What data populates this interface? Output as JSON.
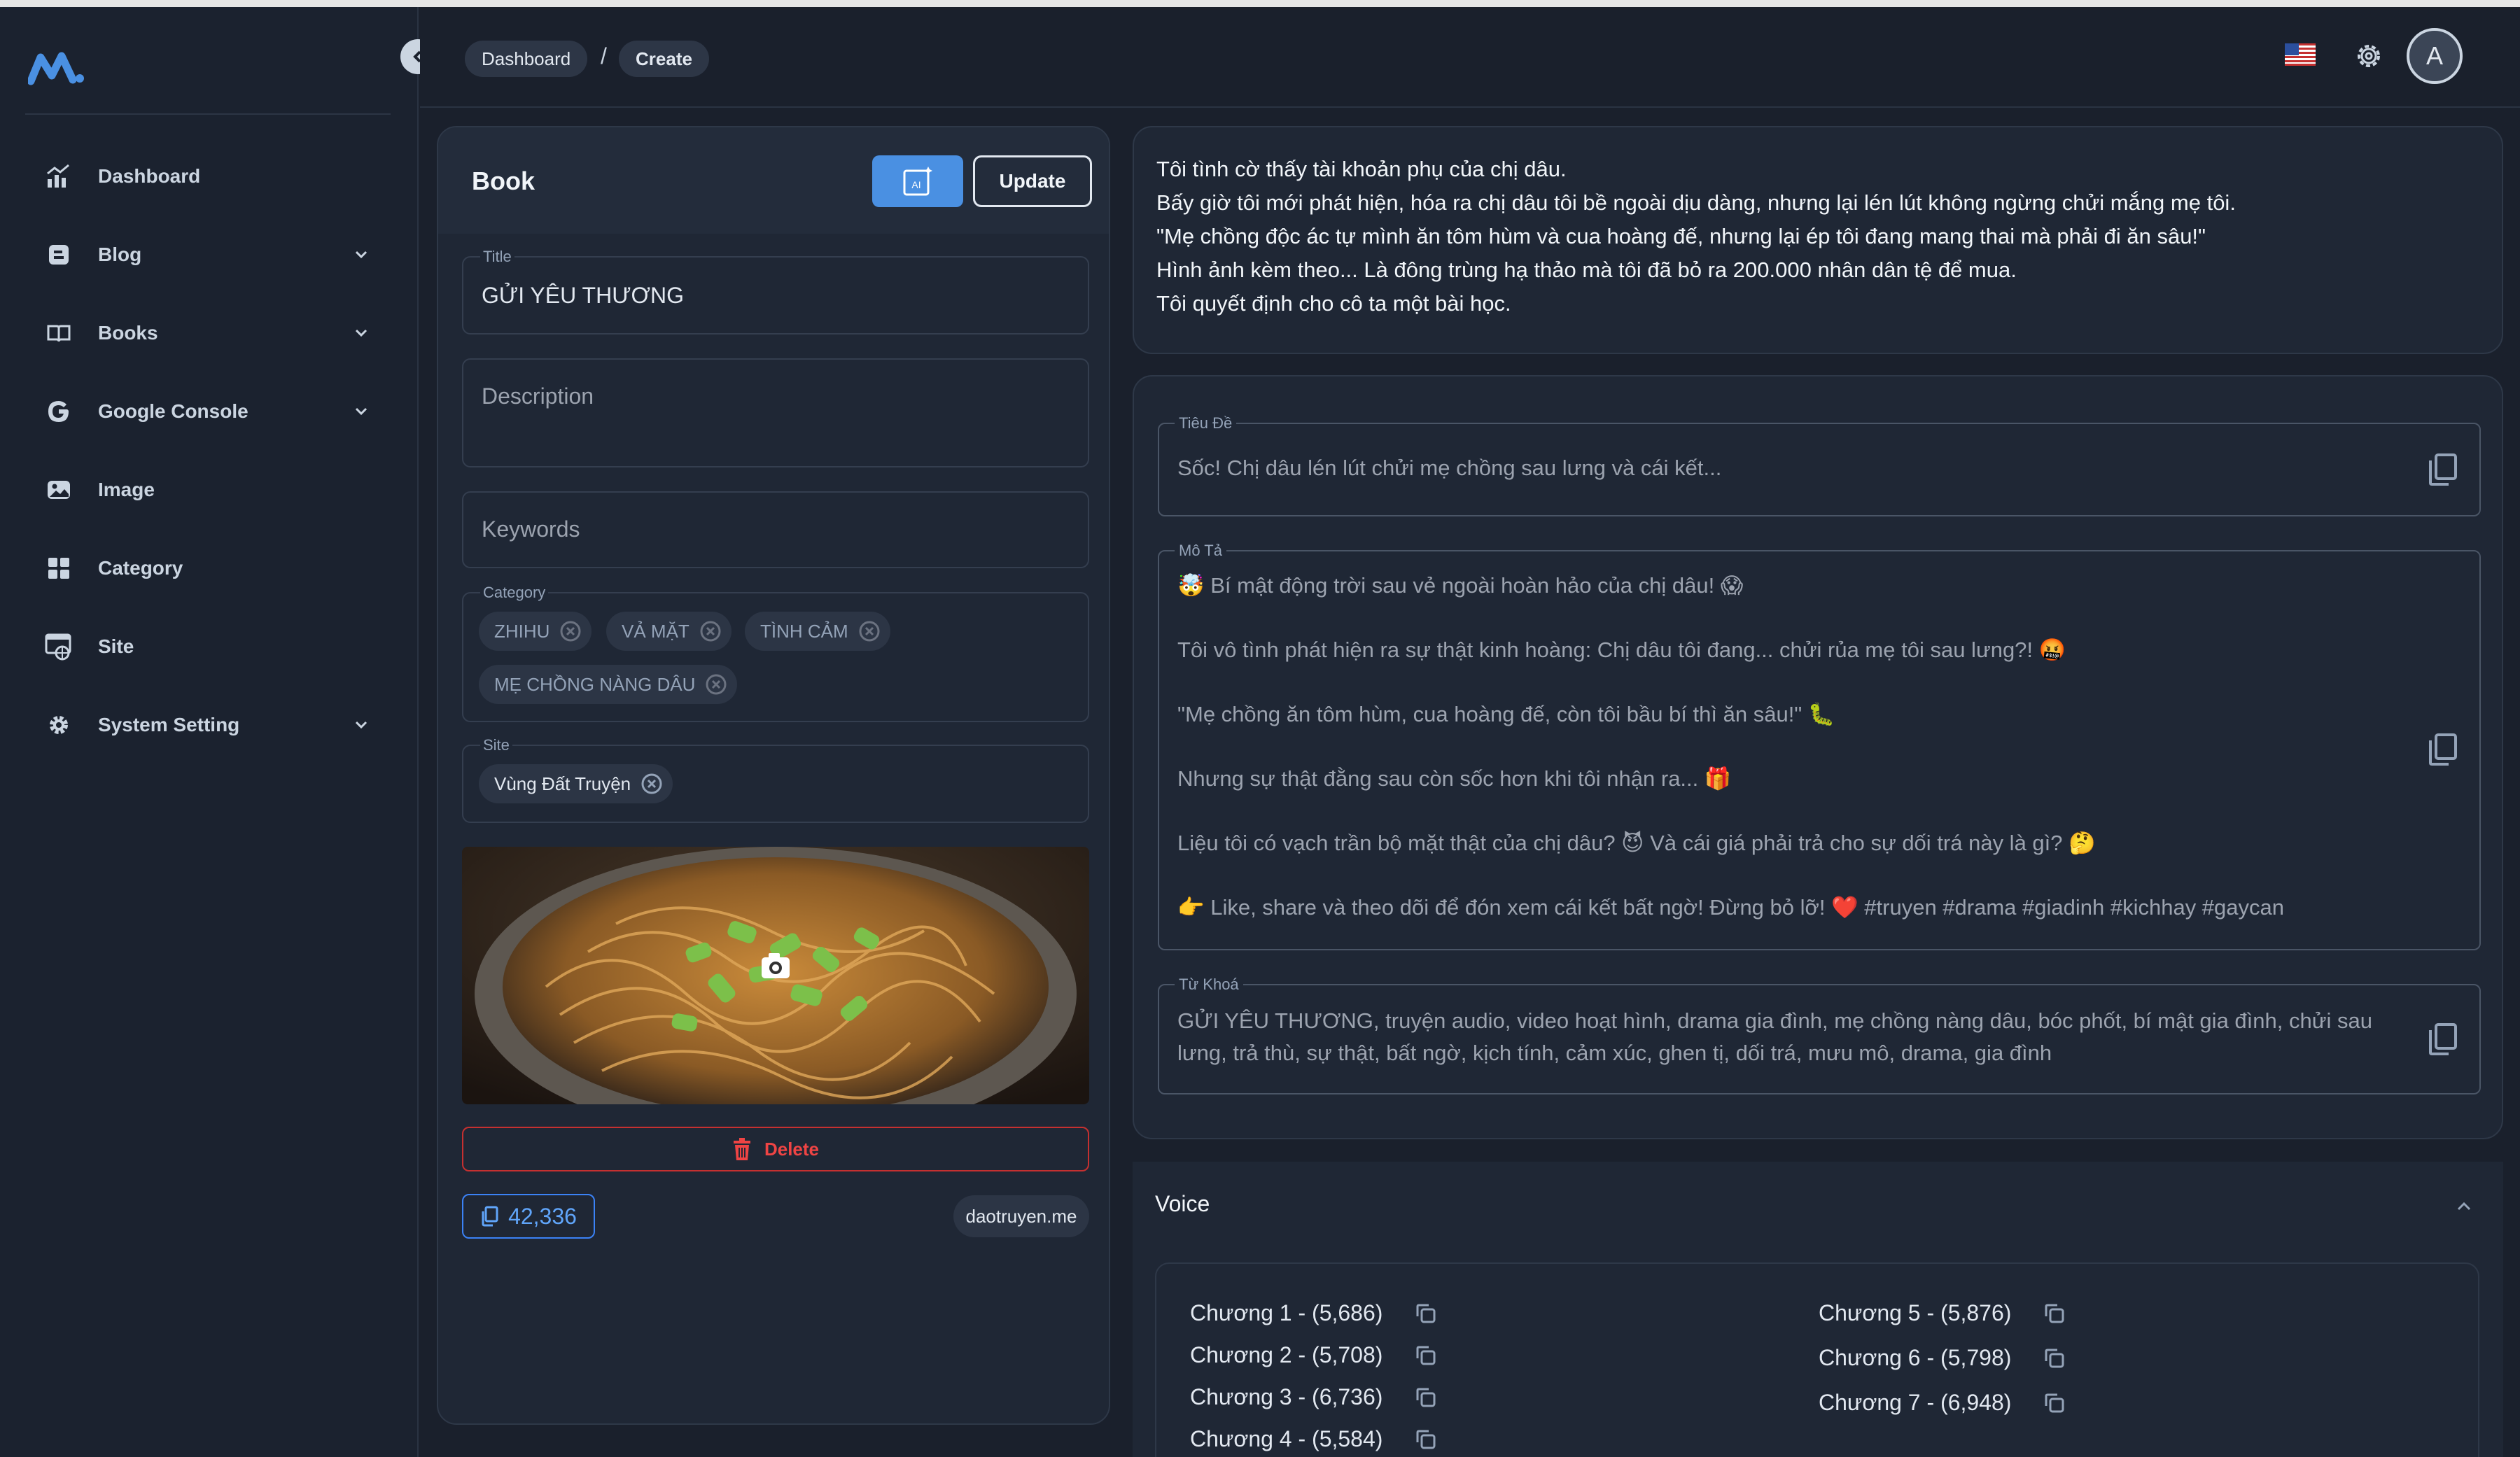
{
  "sidebar": {
    "items": [
      {
        "label": "Dashboard",
        "icon": "chart-icon",
        "has_chevron": false
      },
      {
        "label": "Blog",
        "icon": "blog-icon",
        "has_chevron": true
      },
      {
        "label": "Books",
        "icon": "book-open-icon",
        "has_chevron": true
      },
      {
        "label": "Google Console",
        "icon": "google-icon",
        "has_chevron": true
      },
      {
        "label": "Image",
        "icon": "image-icon",
        "has_chevron": false
      },
      {
        "label": "Category",
        "icon": "grid-icon",
        "has_chevron": false
      },
      {
        "label": "Site",
        "icon": "site-icon",
        "has_chevron": false
      },
      {
        "label": "System Setting",
        "icon": "gear-icon",
        "has_chevron": true
      }
    ]
  },
  "header": {
    "breadcrumb": [
      "Dashboard",
      "Create"
    ],
    "separator": "/",
    "avatar_letter": "A",
    "flag": "us-flag-icon"
  },
  "book": {
    "panel_title": "Book",
    "update_label": "Update",
    "ai_label": "AI",
    "title_legend": "Title",
    "title_value": "GỬI YÊU THƯƠNG",
    "description_placeholder": "Description",
    "keywords_placeholder": "Keywords",
    "category_legend": "Category",
    "categories": [
      "ZHIHU",
      "VẢ MẶT",
      "TÌNH CẢM",
      "MẸ CHỒNG NÀNG DÂU"
    ],
    "site_legend": "Site",
    "site_value": "Vùng Đất Truyện",
    "delete_label": "Delete",
    "count": "42,336",
    "domain": "daotruyen.me"
  },
  "summary": {
    "lines": [
      "Tôi tình cờ thấy tài khoản phụ của chị dâu.",
      "Bấy giờ tôi mới phát hiện, hóa ra chị dâu tôi bề ngoài dịu dàng, nhưng lại lén lút không ngừng chửi mắng mẹ tôi.",
      "\"Mẹ chồng độc ác tự mình ăn tôm hùm và cua hoàng đế, nhưng lại ép tôi đang mang thai mà phải đi ăn sâu!\"",
      "Hình ảnh kèm theo... Là đông trùng hạ thảo mà tôi đã bỏ ra 200.000 nhân dân tệ để mua.",
      "Tôi quyết định cho cô ta một bài học."
    ]
  },
  "generated": {
    "title_legend": "Tiêu Đề",
    "title_value": "Sốc! Chị dâu lén lút chửi mẹ chồng sau lưng và cái kết...",
    "desc_legend": "Mô Tả",
    "desc_lines": [
      "🤯 Bí mật động trời sau vẻ ngoài hoàn hảo của chị dâu! 😱",
      "Tôi vô tình phát hiện ra sự thật kinh hoàng: Chị dâu tôi đang... chửi rủa mẹ tôi sau lưng?! 🤬",
      "\"Mẹ chồng ăn tôm hùm, cua hoàng đế, còn tôi bầu bí thì ăn sâu!\" 🐛",
      "Nhưng sự thật đằng sau còn sốc hơn khi tôi nhận ra... 🎁",
      "Liệu tôi có vạch trần bộ mặt thật của chị dâu? 😈 Và cái giá phải trả cho sự dối trá này là gì? 🤔",
      "👉 Like, share và theo dõi để đón xem cái kết bất ngờ! Đừng bỏ lỡ! ❤️ #truyen #drama #giadinh #kichhay #gaycan"
    ],
    "keywords_legend": "Từ Khoá",
    "keywords_value": "GỬI YÊU THƯƠNG, truyện audio, video hoạt hình, drama gia đình, mẹ chồng nàng dâu, bóc phốt, bí mật gia đình, chửi sau lưng, trả thù, sự thật, bất ngờ, kịch tính, cảm xúc, ghen tị, dối trá, mưu mô, drama, gia đình"
  },
  "voice": {
    "title": "Voice",
    "chapters_left": [
      "Chương 1 - (5,686)",
      "Chương 2 - (5,708)",
      "Chương 3 - (6,736)",
      "Chương 4 - (5,584)"
    ],
    "chapters_right": [
      "Chương 5 - (5,876)",
      "Chương 6 - (5,798)",
      "Chương 7 - (6,948)"
    ]
  },
  "colors": {
    "accent": "#4a90e2",
    "danger": "#ef4444",
    "background": "#1a202c",
    "panel": "#1f2735"
  }
}
